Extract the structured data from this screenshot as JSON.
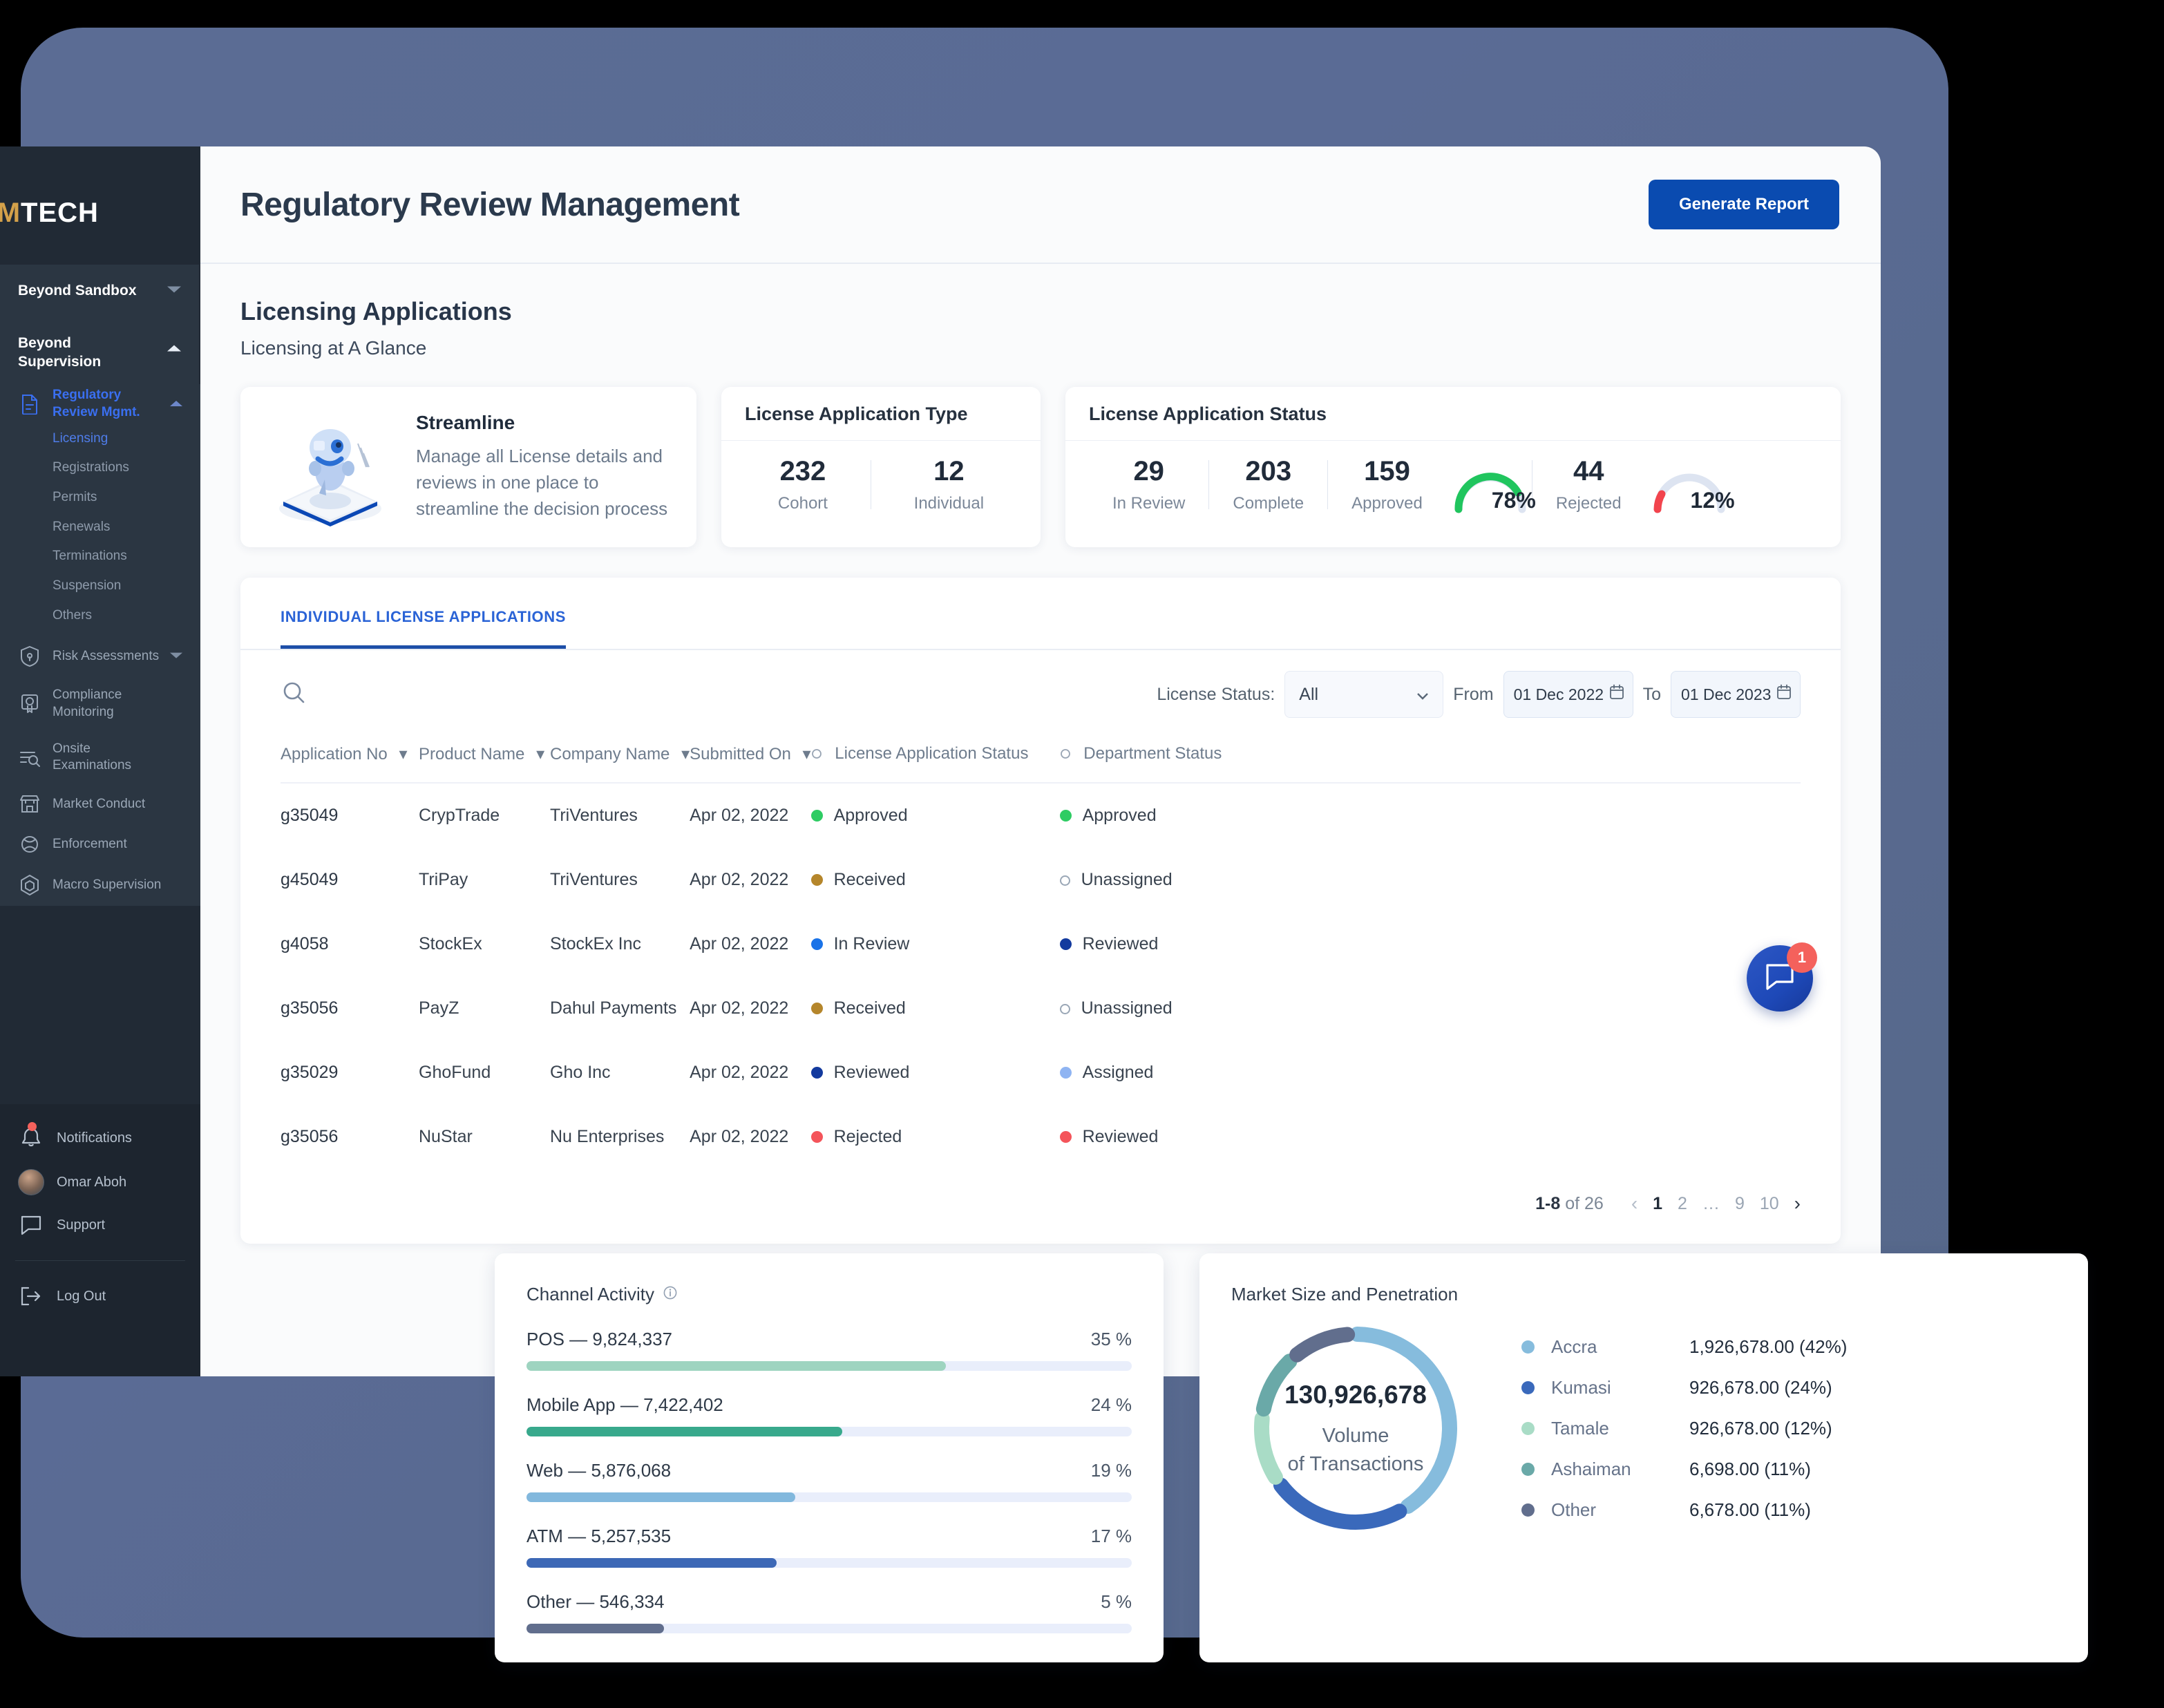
{
  "sidebar": {
    "logo": {
      "prefix": "E",
      "accent": "M",
      "suffix": "TECH",
      "full": "EMTECH"
    },
    "groups": [
      {
        "title": "Beyond Sandbox",
        "expanded": false
      },
      {
        "title": "Beyond Supervision",
        "expanded": true
      }
    ],
    "active_parent": "Regulatory Review Mgmt.",
    "sub_items": [
      {
        "label": "Licensing",
        "state": "active"
      },
      {
        "label": "Registrations",
        "state": "normal"
      },
      {
        "label": "Permits",
        "state": "normal"
      },
      {
        "label": "Renewals",
        "state": "normal"
      },
      {
        "label": "Terminations",
        "state": "normal"
      },
      {
        "label": "Suspension",
        "state": "normal"
      },
      {
        "label": "Others",
        "state": "normal"
      }
    ],
    "nav_items": [
      {
        "label": "Risk Assessments",
        "icon": "shield-icon",
        "caret": true
      },
      {
        "label": "Compliance Monitoring",
        "icon": "certificate-icon",
        "caret": false
      },
      {
        "label": "Onsite Examinations",
        "icon": "list-search-icon",
        "caret": false
      },
      {
        "label": "Market Conduct",
        "icon": "storefront-icon",
        "caret": false
      },
      {
        "label": "Enforcement",
        "icon": "gavel-icon",
        "caret": false
      },
      {
        "label": "Macro Supervision",
        "icon": "hexagon-icon",
        "caret": false
      }
    ],
    "bottom_items": [
      {
        "label": "Notifications",
        "icon": "bell-icon",
        "badge": true
      },
      {
        "label": "Omar Aboh",
        "icon": "avatar"
      },
      {
        "label": "Support",
        "icon": "chat-icon"
      }
    ],
    "logout_label": "Log Out"
  },
  "header": {
    "title": "Regulatory Review Management",
    "generate_report_label": "Generate Report"
  },
  "section": {
    "title": "Licensing Applications",
    "subtitle": "Licensing at A Glance"
  },
  "streamline_card": {
    "title": "Streamline",
    "description": "Manage all License details and reviews in one place to streamline the decision process",
    "icon": "robot-illustration"
  },
  "license_type_card": {
    "title": "License Application Type",
    "stats": [
      {
        "num": "232",
        "label": "Cohort"
      },
      {
        "num": "12",
        "label": "Individual"
      }
    ]
  },
  "license_status_card": {
    "title": "License Application Status",
    "stats": [
      {
        "num": "29",
        "label": "In Review"
      },
      {
        "num": "203",
        "label": "Complete"
      },
      {
        "num": "159",
        "label": "Approved",
        "gauge": "78%",
        "gauge_color": "#20c55e",
        "gauge_value": 78
      },
      {
        "num": "44",
        "label": "Rejected",
        "gauge": "12%",
        "gauge_color": "#f2444d",
        "gauge_value": 12
      }
    ]
  },
  "tabs": [
    {
      "label": "INDIVIDUAL LICENSE APPLICATIONS",
      "active": true
    }
  ],
  "filters": {
    "search_icon": "search-icon",
    "license_status_label": "License Status:",
    "license_status_value": "All",
    "from_label": "From",
    "from_value": "01 Dec 2022",
    "to_label": "To",
    "to_value": "01 Dec 2023"
  },
  "table": {
    "columns": [
      {
        "label": "Application No",
        "sortable": true,
        "ring": false
      },
      {
        "label": "Product Name",
        "sortable": true,
        "ring": false
      },
      {
        "label": "Company Name",
        "sortable": true,
        "ring": false
      },
      {
        "label": "Submitted On",
        "sortable": true,
        "ring": false
      },
      {
        "label": "License Application Status",
        "sortable": false,
        "ring": true
      },
      {
        "label": "Department Status",
        "sortable": false,
        "ring": true
      }
    ],
    "rows": [
      {
        "app_no": "g35049",
        "product": "CrypTrade",
        "company": "TriVentures",
        "submitted": "Apr 02, 2022",
        "lic_status": "Approved",
        "lic_color": "#2ecc63",
        "dep_status": "Approved",
        "dep_color": "#2ecc63"
      },
      {
        "app_no": "g45049",
        "product": "TriPay",
        "company": "TriVentures",
        "submitted": "Apr 02, 2022",
        "lic_status": "Received",
        "lic_color": "#b5862b",
        "dep_status": "Unassigned",
        "dep_color": "hollow"
      },
      {
        "app_no": "g4058",
        "product": "StockEx",
        "company": "StockEx Inc",
        "submitted": "Apr 02, 2022",
        "lic_status": "In Review",
        "lic_color": "#1a73e8",
        "dep_status": "Reviewed",
        "dep_color": "#133a9e"
      },
      {
        "app_no": "g35056",
        "product": "PayZ",
        "company": "Dahul Payments",
        "submitted": "Apr 02, 2022",
        "lic_status": "Received",
        "lic_color": "#b5862b",
        "dep_status": "Unassigned",
        "dep_color": "hollow"
      },
      {
        "app_no": "g35029",
        "product": "GhoFund",
        "company": "Gho Inc",
        "submitted": "Apr 02, 2022",
        "lic_status": "Reviewed",
        "lic_color": "#133a9e",
        "dep_status": "Assigned",
        "dep_color": "#8fb4f2"
      },
      {
        "app_no": "g35056",
        "product": "NuStar",
        "company": "Nu Enterprises",
        "submitted": "Apr 02, 2022",
        "lic_status": "Rejected",
        "lic_color": "#f4545a",
        "dep_status": "Reviewed",
        "dep_color": "#f4545a"
      }
    ]
  },
  "pagination": {
    "range_bold": "1-8",
    "range_rest": " of 26",
    "prev": "‹",
    "next": "›",
    "pages": [
      {
        "label": "1",
        "current": true
      },
      {
        "label": "2",
        "current": false
      },
      {
        "label": "…",
        "current": false
      },
      {
        "label": "9",
        "current": false
      },
      {
        "label": "10",
        "current": false
      }
    ]
  },
  "chart_data": [
    {
      "type": "bar",
      "title": "Channel Activity",
      "orientation": "horizontal",
      "xlabel": "",
      "ylabel": "",
      "ylim": [
        0,
        100
      ],
      "categories": [
        "POS",
        "Mobile App",
        "Web",
        "ATM",
        "Other"
      ],
      "values": [
        35,
        24,
        19,
        17,
        5
      ],
      "value_suffix": " %",
      "raw_counts": [
        "9,824,337",
        "7,422,402",
        "5,876,068",
        "5,257,535",
        "546,334"
      ],
      "labels": [
        "POS — 9,824,337",
        "Mobile App — 7,422,402",
        "Web — 5,876,068",
        "ATM — 5,257,535",
        "Other — 546,334"
      ],
      "pct_labels": [
        "35 %",
        "24 %",
        "19 %",
        "17 %",
        "5 %"
      ],
      "colors": [
        "#9ed4c0",
        "#38a98c",
        "#82b8dd",
        "#3d68b6",
        "#616e8d"
      ],
      "track_color": "#e9eefb",
      "grid": false,
      "legend": "none",
      "info_icon": "info-icon"
    },
    {
      "type": "pie",
      "subtype": "donut",
      "title": "Market Size and Penetration",
      "center_value": "130,926,678",
      "center_caption_line1": "Volume",
      "center_caption_line2": "of Transactions",
      "labels": [
        "Accra",
        "Kumasi",
        "Tamale",
        "Ashaiman",
        "Other"
      ],
      "values": [
        42,
        24,
        12,
        11,
        11
      ],
      "value_texts": [
        "1,926,678.00 (42%)",
        "926,678.00 (24%)",
        "926,678.00 (12%)",
        "6,698.00 (11%)",
        "6,678.00 (11%)"
      ],
      "colors": [
        "#86bcdd",
        "#3a69bb",
        "#a9dcc6",
        "#6aa9a8",
        "#616e8d"
      ],
      "legend": "right",
      "grid": false
    }
  ],
  "chat_fab": {
    "icon": "chat-icon",
    "badge": "1"
  }
}
